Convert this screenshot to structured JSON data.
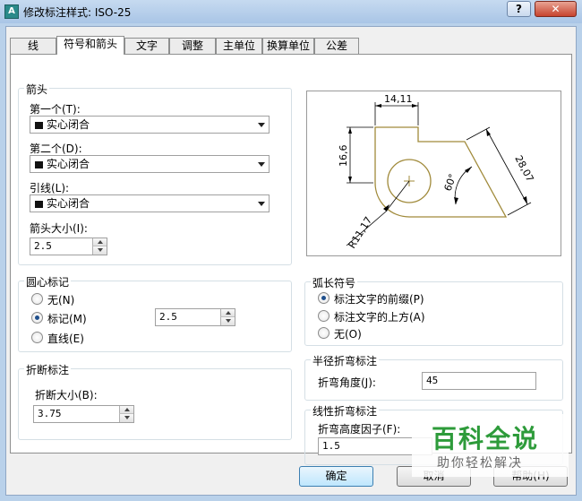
{
  "window": {
    "title": "修改标注样式: ISO-25",
    "app_icon": "A",
    "help_label": "?",
    "close_label": "✕"
  },
  "tabs": [
    {
      "label": "线"
    },
    {
      "label": "符号和箭头",
      "active": true
    },
    {
      "label": "文字"
    },
    {
      "label": "调整"
    },
    {
      "label": "主单位"
    },
    {
      "label": "换算单位"
    },
    {
      "label": "公差"
    }
  ],
  "arrowheads": {
    "title": "箭头",
    "first_label": "第一个(T):",
    "first_value": "实心闭合",
    "second_label": "第二个(D):",
    "second_value": "实心闭合",
    "leader_label": "引线(L):",
    "leader_value": "实心闭合",
    "size_label": "箭头大小(I):",
    "size_value": "2.5"
  },
  "center_marks": {
    "title": "圆心标记",
    "options": [
      {
        "label": "无(N)",
        "checked": false
      },
      {
        "label": "标记(M)",
        "checked": true
      },
      {
        "label": "直线(E)",
        "checked": false
      }
    ],
    "size_value": "2.5"
  },
  "dim_break": {
    "title": "折断标注",
    "size_label": "折断大小(B):",
    "size_value": "3.75"
  },
  "arc_length": {
    "title": "弧长符号",
    "options": [
      {
        "label": "标注文字的前缀(P)",
        "checked": true
      },
      {
        "label": "标注文字的上方(A)",
        "checked": false
      },
      {
        "label": "无(O)",
        "checked": false
      }
    ]
  },
  "radius_jog": {
    "title": "半径折弯标注",
    "angle_label": "折弯角度(J):",
    "angle_value": "45"
  },
  "linear_jog": {
    "title": "线性折弯标注",
    "height_label": "折弯高度因子(F):",
    "height_value": "1.5"
  },
  "preview": {
    "dim_top": "14,11",
    "dim_left": "16,6",
    "dim_right": "28,07",
    "dim_angle": "60°",
    "dim_radius": "R11,17"
  },
  "buttons": {
    "ok": "确定",
    "cancel": "取消",
    "help": "帮助(H)"
  },
  "watermark": {
    "title": "百科全说",
    "subtitle": "助你轻松解决"
  },
  "colors": {
    "titlebar": "#b9d1ea",
    "preview_shape": "#a08a3a",
    "preview_dim": "#000000",
    "watermark_green": "#2d9b3a"
  }
}
